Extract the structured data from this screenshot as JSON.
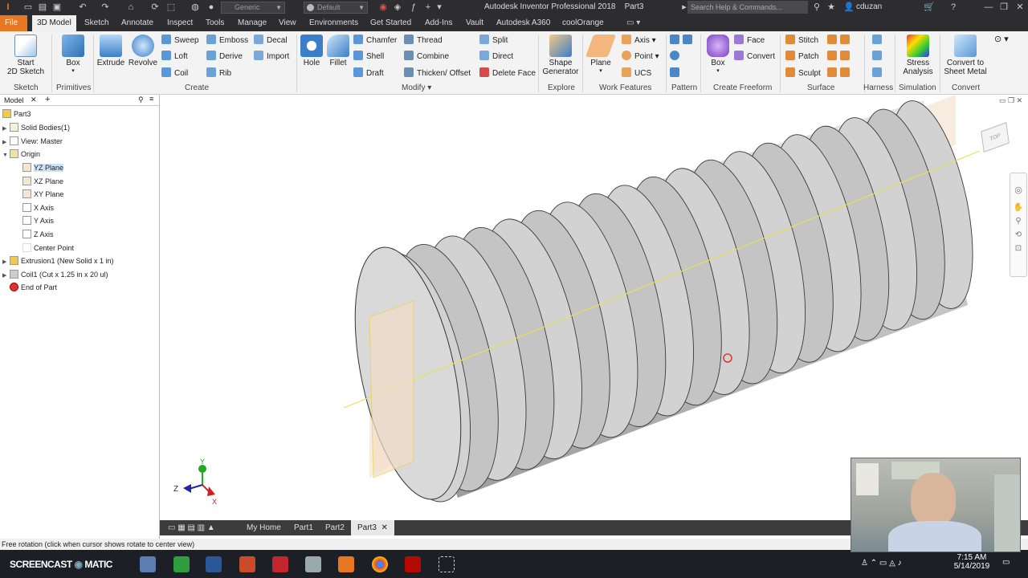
{
  "titlebar": {
    "style_combo": "Generic",
    "appearance_combo": "Default",
    "app_title": "Autodesk Inventor Professional 2018",
    "doc_title": "Part3",
    "search_placeholder": "Search Help & Commands...",
    "user": "cduzan"
  },
  "menu": {
    "file": "File",
    "tabs": [
      "3D Model",
      "Sketch",
      "Annotate",
      "Inspect",
      "Tools",
      "Manage",
      "View",
      "Environments",
      "Get Started",
      "Add-Ins",
      "Vault",
      "Autodesk A360",
      "coolOrange"
    ]
  },
  "ribbon": {
    "sketch": {
      "start_label": "Start",
      "start_label2": "2D Sketch",
      "panel": "Sketch"
    },
    "primitives": {
      "box": "Box",
      "panel": "Primitives"
    },
    "create": {
      "extrude": "Extrude",
      "revolve": "Revolve",
      "sweep": "Sweep",
      "emboss": "Emboss",
      "decal": "Decal",
      "loft": "Loft",
      "derive": "Derive",
      "import": "Import",
      "coil": "Coil",
      "rib": "Rib",
      "panel": "Create"
    },
    "modify": {
      "hole": "Hole",
      "fillet": "Fillet",
      "chamfer": "Chamfer",
      "thread": "Thread",
      "split": "Split",
      "shell": "Shell",
      "combine": "Combine",
      "direct": "Direct",
      "draft": "Draft",
      "thicken": "Thicken/ Offset",
      "delete_face": "Delete Face",
      "panel": "Modify"
    },
    "explore": {
      "shape_gen": "Shape",
      "shape_gen2": "Generator",
      "panel": "Explore"
    },
    "work": {
      "plane": "Plane",
      "axis": "Axis",
      "point": "Point",
      "ucs": "UCS",
      "panel": "Work Features"
    },
    "pattern": {
      "panel": "Pattern"
    },
    "freeform": {
      "box": "Box",
      "face": "Face",
      "convert": "Convert",
      "panel": "Create Freeform"
    },
    "surface": {
      "stitch": "Stitch",
      "patch": "Patch",
      "sculpt": "Sculpt",
      "panel": "Surface"
    },
    "harness": {
      "panel": "Harness"
    },
    "simulation": {
      "stress": "Stress",
      "stress2": "Analysis",
      "panel": "Simulation"
    },
    "convert": {
      "sheet": "Convert to",
      "sheet2": "Sheet Metal",
      "panel": "Convert"
    }
  },
  "browser": {
    "tab": "Model",
    "items": [
      {
        "label": "Part3"
      },
      {
        "label": "Solid Bodies(1)"
      },
      {
        "label": "View: Master"
      },
      {
        "label": "Origin"
      },
      {
        "label": "YZ Plane"
      },
      {
        "label": "XZ Plane"
      },
      {
        "label": "XY Plane"
      },
      {
        "label": "X Axis"
      },
      {
        "label": "Y Axis"
      },
      {
        "label": "Z Axis"
      },
      {
        "label": "Center Point"
      },
      {
        "label": "Extrusion1 (New Solid x 1 in)"
      },
      {
        "label": "Coil1 (Cut x 1.25 in x 20 ul)"
      },
      {
        "label": "End of Part"
      }
    ]
  },
  "viewport": {
    "triad": {
      "x": "X",
      "y": "Y",
      "z": "Z"
    },
    "viewcube": "TOP"
  },
  "doctabs": {
    "home": "My Home",
    "tabs": [
      "Part1",
      "Part2",
      "Part3"
    ]
  },
  "status": {
    "text": "Free rotation (click when cursor shows rotate to center view)"
  },
  "taskbar": {
    "brand": "SCREENCAST",
    "brand2": "MATIC",
    "time": "7:15 AM",
    "date": "5/14/2019"
  },
  "colors": {
    "accent_file": "#e87722",
    "dark_chrome": "#2d2d30",
    "thread_gray": "#c9c9c9",
    "work_plane": "#f3ddc7"
  }
}
